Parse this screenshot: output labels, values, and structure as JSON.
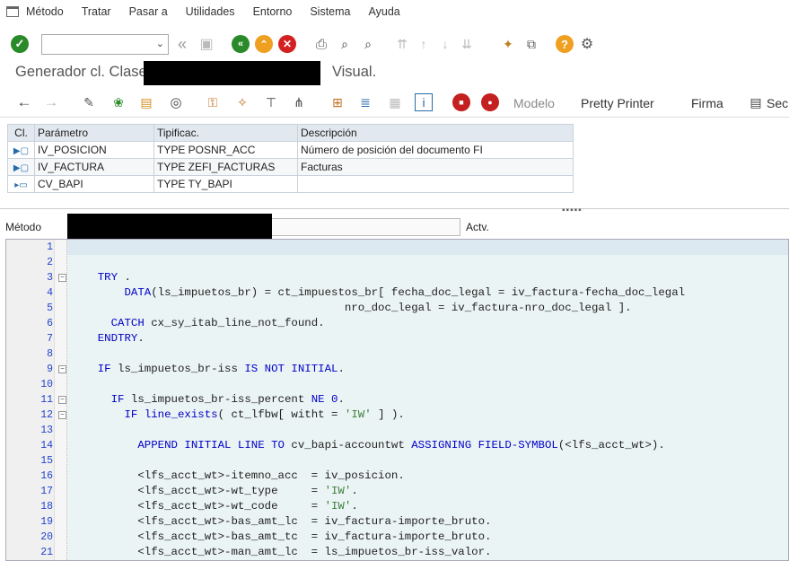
{
  "menu": [
    "Método",
    "Tratar",
    "Pasar a",
    "Utilidades",
    "Entorno",
    "Sistema",
    "Ayuda"
  ],
  "window_title_prefix": "Generador cl. Clase",
  "window_title_suffix": "Visual.",
  "toolbar2": {
    "modelo": "Modelo",
    "pretty": "Pretty Printer",
    "firma": "Firma",
    "sec": "Sec"
  },
  "params": {
    "headers": [
      "Cl.",
      "Parámetro",
      "Tipificac.",
      "Descripción"
    ],
    "rows": [
      {
        "param": "IV_POSICION",
        "type": "TYPE POSNR_ACC",
        "desc": "Número de posición del documento FI"
      },
      {
        "param": "IV_FACTURA",
        "type": "TYPE ZEFI_FACTURAS",
        "desc": "Facturas"
      },
      {
        "param": "CV_BAPI",
        "type": "TYPE TY_BAPI",
        "desc": ""
      }
    ]
  },
  "method_label": "Método",
  "actv_label": "Actv.",
  "code_lines": [
    {
      "n": "1",
      "html": ""
    },
    {
      "n": "2",
      "html": ""
    },
    {
      "n": "3",
      "html": "    <span class='kw'>TRY</span> ."
    },
    {
      "n": "4",
      "html": "        <span class='kw'>DATA</span>(ls_impuetos_br) = ct_impuestos_br[ fecha_doc_legal = iv_factura-fecha_doc_legal"
    },
    {
      "n": "5",
      "html": "                                         nro_doc_legal = iv_factura-nro_doc_legal ]."
    },
    {
      "n": "6",
      "html": "      <span class='kw'>CATCH</span> cx_sy_itab_line_not_found."
    },
    {
      "n": "7",
      "html": "    <span class='kw'>ENDTRY</span>."
    },
    {
      "n": "8",
      "html": ""
    },
    {
      "n": "9",
      "html": "    <span class='kw'>IF</span> ls_impuetos_br-iss <span class='kw'>IS NOT INITIAL</span>."
    },
    {
      "n": "10",
      "html": ""
    },
    {
      "n": "11",
      "html": "      <span class='kw'>IF</span> ls_impuetos_br-iss_percent <span class='kw'>NE</span> <span class='num'>0</span>."
    },
    {
      "n": "12",
      "html": "        <span class='kw'>IF</span> <span class='kw'>line_exists</span>( ct_lfbw[ witht = <span class='str'>'IW'</span> ] )."
    },
    {
      "n": "13",
      "html": ""
    },
    {
      "n": "14",
      "html": "          <span class='kw'>APPEND INITIAL LINE TO</span> cv_bapi-accountwt <span class='kw'>ASSIGNING FIELD-SYMBOL</span>(&lt;lfs_acct_wt&gt;)."
    },
    {
      "n": "15",
      "html": ""
    },
    {
      "n": "16",
      "html": "          &lt;lfs_acct_wt&gt;-itemno_acc  = iv_posicion."
    },
    {
      "n": "17",
      "html": "          &lt;lfs_acct_wt&gt;-wt_type     = <span class='str'>'IW'</span>."
    },
    {
      "n": "18",
      "html": "          &lt;lfs_acct_wt&gt;-wt_code     = <span class='str'>'IW'</span>."
    },
    {
      "n": "19",
      "html": "          &lt;lfs_acct_wt&gt;-bas_amt_lc  = iv_factura-importe_bruto."
    },
    {
      "n": "20",
      "html": "          &lt;lfs_acct_wt&gt;-bas_amt_tc  = iv_factura-importe_bruto."
    },
    {
      "n": "21",
      "html": "          &lt;lfs_acct_wt&gt;-man_amt_lc  = ls_impuetos_br-iss_valor."
    }
  ],
  "colors": {
    "accent_green": "#2a8a2a",
    "accent_orange": "#f0a020",
    "accent_red": "#d42020"
  }
}
